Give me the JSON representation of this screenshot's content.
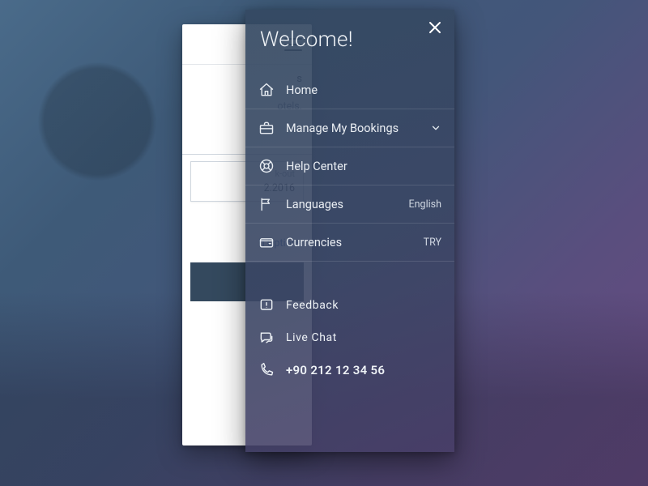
{
  "underlying": {
    "heading_fragment": "s",
    "subheading_fragment": "otels.",
    "checkout_label_fragment": "k-out",
    "checkout_value_fragment": "2.2016",
    "search_options_fragment": "h Options"
  },
  "drawer": {
    "title": "Welcome!",
    "menu": [
      {
        "id": "home",
        "label": "Home"
      },
      {
        "id": "bookings",
        "label": "Manage My Bookings",
        "expandable": true
      },
      {
        "id": "help",
        "label": "Help Center"
      },
      {
        "id": "languages",
        "label": "Languages",
        "trailing": "English"
      },
      {
        "id": "currencies",
        "label": "Currencies",
        "trailing": "TRY"
      }
    ],
    "secondary": {
      "feedback": "Feedback",
      "live_chat": "Live Chat",
      "phone": "+90 212 12 34 56"
    }
  }
}
